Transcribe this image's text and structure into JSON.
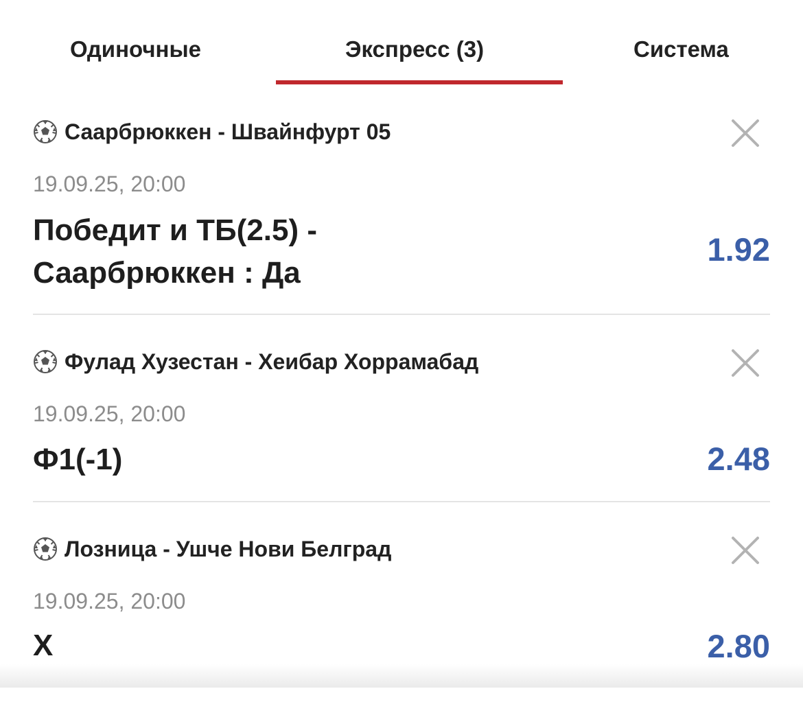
{
  "tabs": {
    "singles": "Одиночные",
    "express": "Экспресс (3)",
    "system": "Система",
    "active": "express",
    "active_color": "#c0282d"
  },
  "bets": [
    {
      "sport_icon": "soccer-ball-icon",
      "match": "Саарбрюккен - Швайнфурт 05",
      "date": "19.09.25,  20:00",
      "outcome": "Победит и ТБ(2.5) - Саарбрюккен : Да",
      "odds": "1.92"
    },
    {
      "sport_icon": "soccer-ball-icon",
      "match": "Фулад Хузестан - Хеибар Хоррамабад",
      "date": "19.09.25,  20:00",
      "outcome": "Ф1(-1)",
      "odds": "2.48"
    },
    {
      "sport_icon": "soccer-ball-icon",
      "match": "Лозница - Ушче Нови Белград",
      "date": "19.09.25,  20:00",
      "outcome": "Х",
      "odds": "2.80"
    }
  ],
  "colors": {
    "odds": "#3b5fa8",
    "date": "#8c8c8c",
    "close_icon": "#b3b3b3"
  }
}
